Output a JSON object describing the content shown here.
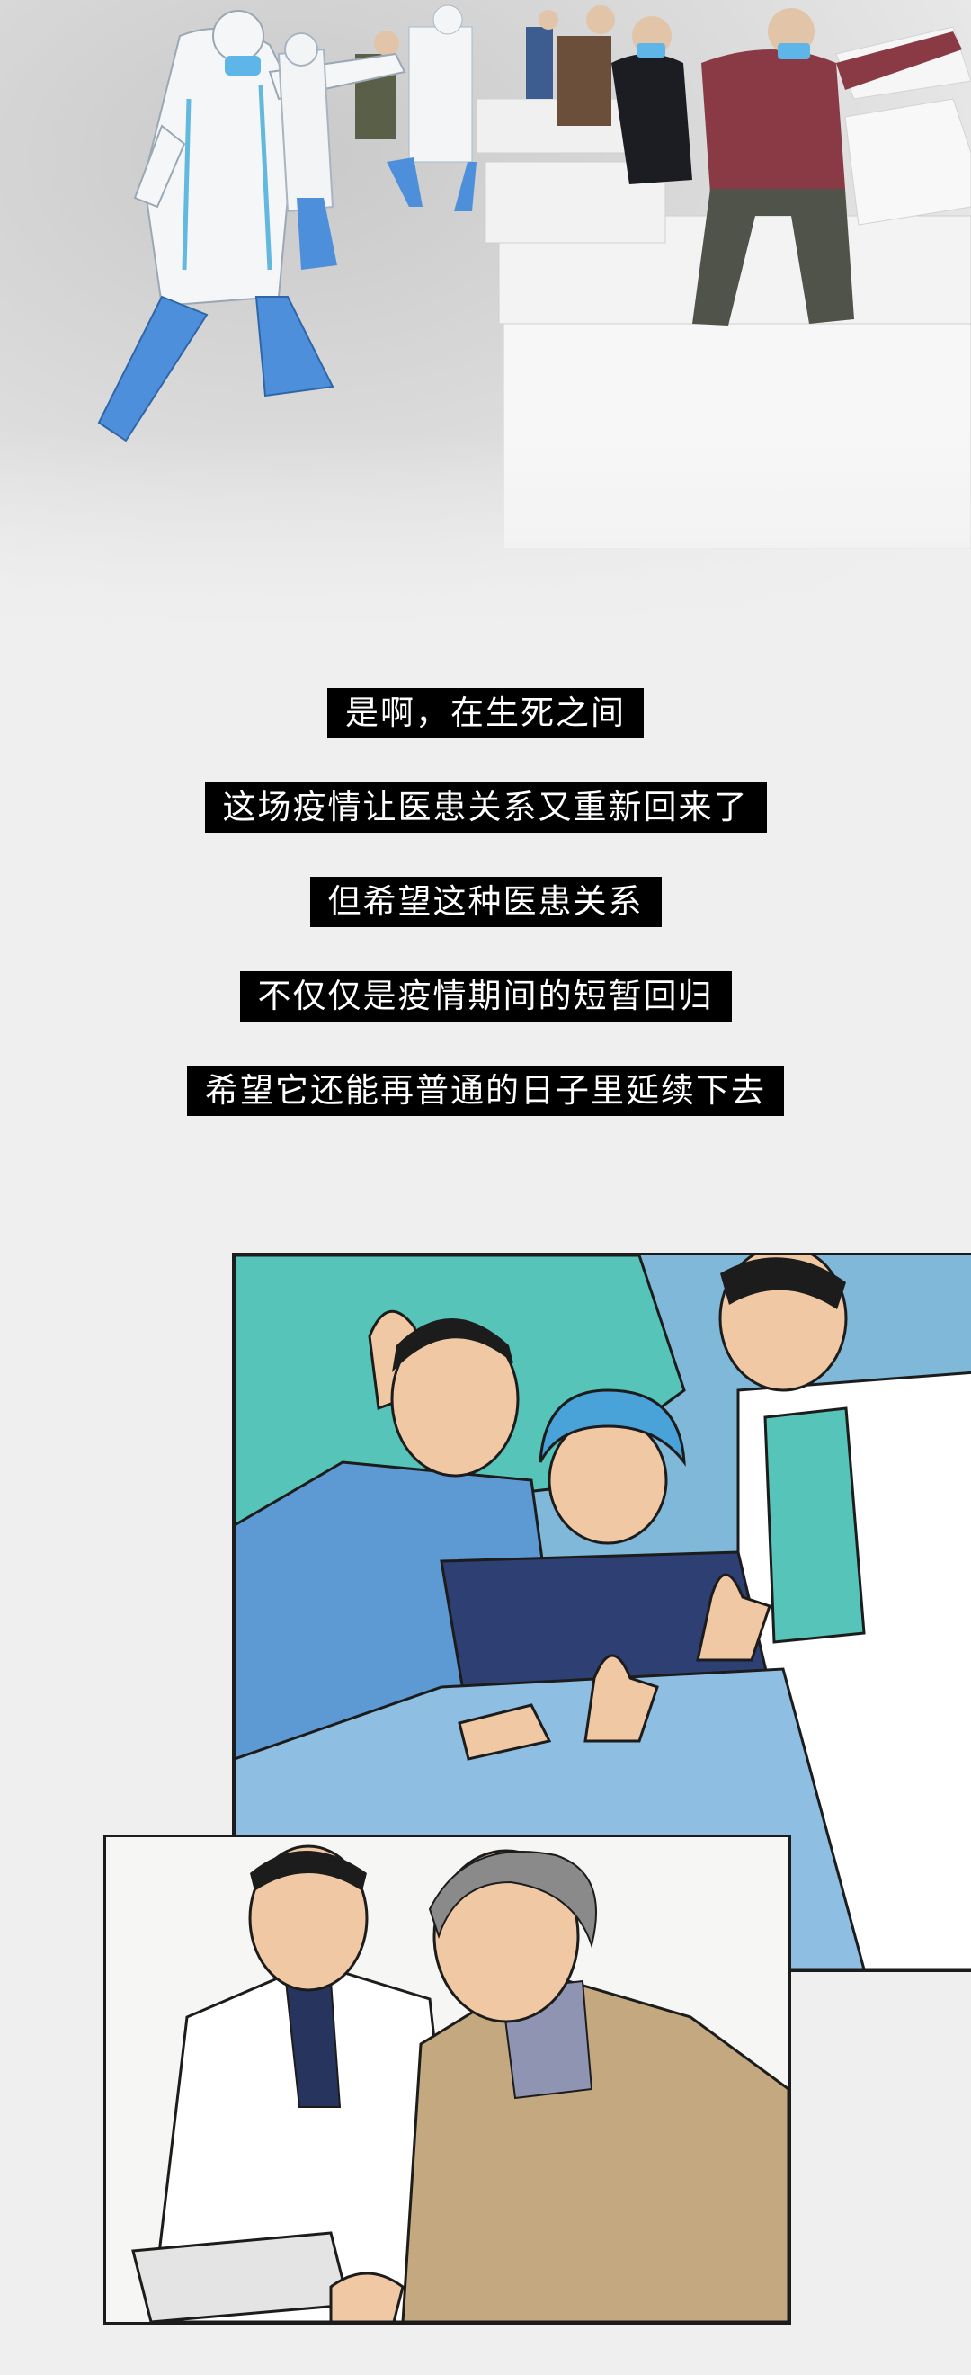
{
  "captions": [
    "是啊，在生死之间",
    "这场疫情让医患关系又重新回来了",
    "但希望这种医患关系",
    "不仅仅是疫情期间的短暂回归",
    "希望它还能再普通的日子里延续下去"
  ],
  "colors": {
    "background": "#efefef",
    "caption_bg": "#000000",
    "caption_text": "#ffffff",
    "scrub_teal": "#56c4b8",
    "scrub_blue": "#5d9ad3",
    "patient_navy": "#2d3f73",
    "cap_blue": "#4aa3d8",
    "protective_suit": "#f4f6f8",
    "shoe_cover_blue": "#4e8fdc"
  },
  "illustrations": {
    "top": "medical-staff-and-patients-dancing-in-ward-illustration",
    "panel_1": "doctors-nurses-thumbs-up-with-patient-illustration",
    "panel_2": "doctor-reviewing-clipboard-with-elderly-patient-illustration"
  }
}
